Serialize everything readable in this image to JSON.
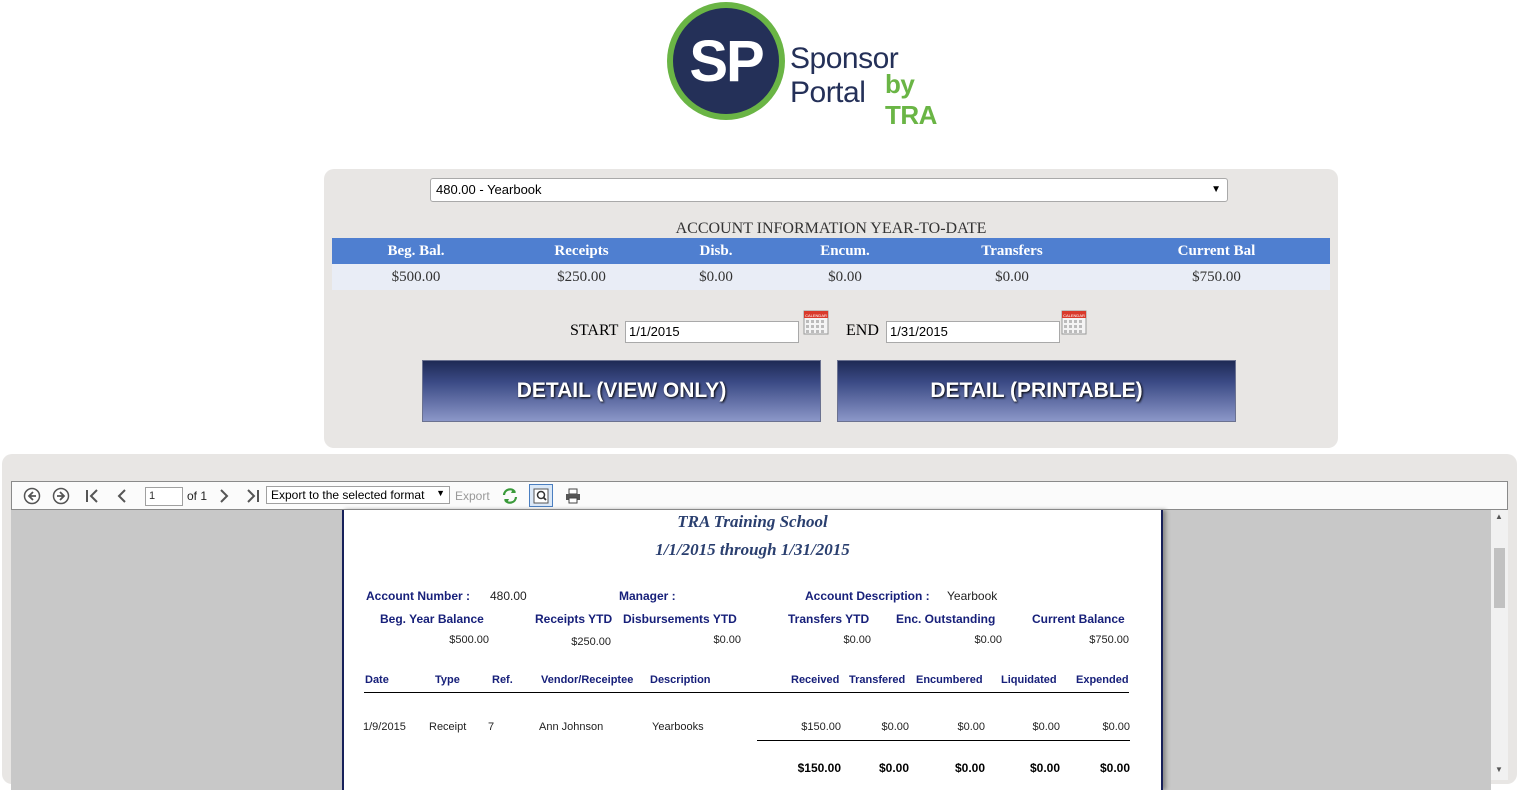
{
  "logo": {
    "initials": "SP",
    "name": "Sponsor Portal",
    "by": "by TRA"
  },
  "account_select": {
    "value": "480.00 - Yearbook"
  },
  "account_info": {
    "title": "ACCOUNT INFORMATION YEAR-TO-DATE",
    "headers": [
      "Beg. Bal.",
      "Receipts",
      "Disb.",
      "Encum.",
      "Transfers",
      "Current Bal"
    ],
    "values": [
      "$500.00",
      "$250.00",
      "$0.00",
      "$0.00",
      "$0.00",
      "$750.00"
    ]
  },
  "date_range": {
    "start_label": "START",
    "start_value": "1/1/2015",
    "end_label": "END",
    "end_value": "1/31/2015",
    "calendar_text": "CALENDAR"
  },
  "buttons": {
    "view_only": "DETAIL (VIEW ONLY)",
    "printable": "DETAIL (PRINTABLE)"
  },
  "toolbar": {
    "page_value": "1",
    "page_of": "of 1",
    "export_format": "Export to the selected format",
    "export_label": "Export"
  },
  "report": {
    "school": "TRA Training School",
    "period": "1/1/2015 through 1/31/2015",
    "account_number_label": "Account Number :",
    "account_number": "480.00",
    "manager_label": "Manager :",
    "account_description_label": "Account Description :",
    "account_description": "Yearbook",
    "summary_headers": [
      "Beg. Year Balance",
      "Receipts YTD",
      "Disbursements YTD",
      "Transfers YTD",
      "Enc. Outstanding",
      "Current Balance"
    ],
    "summary_values": [
      "$500.00",
      "$250.00",
      "$0.00",
      "$0.00",
      "$0.00",
      "$750.00"
    ],
    "columns": [
      "Date",
      "Type",
      "Ref.",
      "Vendor/Receiptee",
      "Description",
      "Received",
      "Transfered",
      "Encumbered",
      "Liquidated",
      "Expended"
    ],
    "rows": [
      [
        "1/9/2015",
        "Receipt",
        "7",
        "Ann Johnson",
        "Yearbooks",
        "$150.00",
        "$0.00",
        "$0.00",
        "$0.00",
        "$0.00"
      ]
    ],
    "totals": [
      "$150.00",
      "$0.00",
      "$0.00",
      "$0.00",
      "$0.00"
    ]
  },
  "colors": {
    "navy": "#243058",
    "green": "#6ab545",
    "table_header": "#4f7fd0",
    "report_header_text": "#17207a"
  }
}
